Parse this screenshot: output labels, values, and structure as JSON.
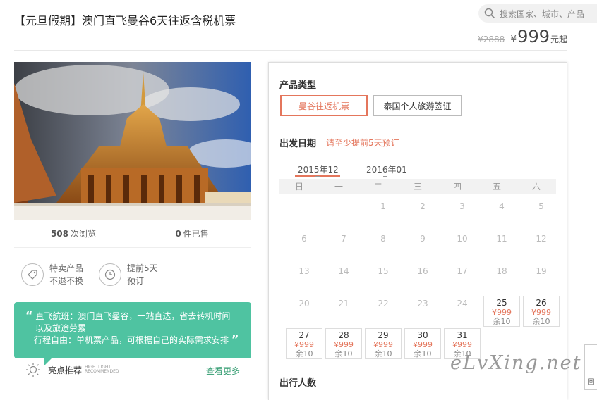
{
  "header": {
    "title": "【元旦假期】澳门直飞曼谷6天往返含税机票",
    "search_placeholder": "搜索国家、城市、产品",
    "old_price": "¥2888",
    "currency": "¥",
    "price": "999",
    "price_suffix": "元起"
  },
  "stats": {
    "views_count": "508",
    "views_label": "次浏览",
    "sold_count": "0",
    "sold_label": "件已售"
  },
  "features": [
    {
      "icon": "tag-icon",
      "line1": "特卖产品",
      "line2": "不退不换"
    },
    {
      "icon": "clock-icon",
      "line1": "提前5天",
      "line2": "预订"
    }
  ],
  "highlight": {
    "open_quote": "“",
    "close_quote": "”",
    "line1": "直飞航班：澳门直飞曼谷，一站直达，省去转机时间",
    "line2": "以及旅途劳累",
    "line3": "行程自由：单机票产品，可根据自己的实际需求安排",
    "label": "亮点推荐",
    "en1": "HIGHTLIGHT",
    "en2": "RECOMMENDED",
    "more": "查看更多"
  },
  "booking": {
    "product_type_label": "产品类型",
    "options": [
      "曼谷往返机票",
      "泰国个人旅游签证"
    ],
    "selected_option": 0,
    "date_label": "出发日期",
    "date_hint": "请至少提前5天预订",
    "months": [
      "2015年12",
      "2016年01"
    ],
    "active_month": 0,
    "weekdays": [
      "日",
      "一",
      "二",
      "三",
      "四",
      "五",
      "六"
    ],
    "first_weekday": 2,
    "days_in_month": 31,
    "available": [
      {
        "day": "25",
        "price": "¥999",
        "remain": "余10"
      },
      {
        "day": "26",
        "price": "¥999",
        "remain": "余10"
      },
      {
        "day": "27",
        "price": "¥999",
        "remain": "余10"
      },
      {
        "day": "28",
        "price": "¥999",
        "remain": "余10"
      },
      {
        "day": "29",
        "price": "¥999",
        "remain": "余10"
      },
      {
        "day": "30",
        "price": "¥999",
        "remain": "余10"
      },
      {
        "day": "31",
        "price": "¥999",
        "remain": "余10"
      }
    ],
    "people_label": "出行人数"
  },
  "watermark": "eLvXing.net",
  "side_button": "回",
  "colors": {
    "accent": "#e4765c",
    "green": "#4fc3a1"
  }
}
